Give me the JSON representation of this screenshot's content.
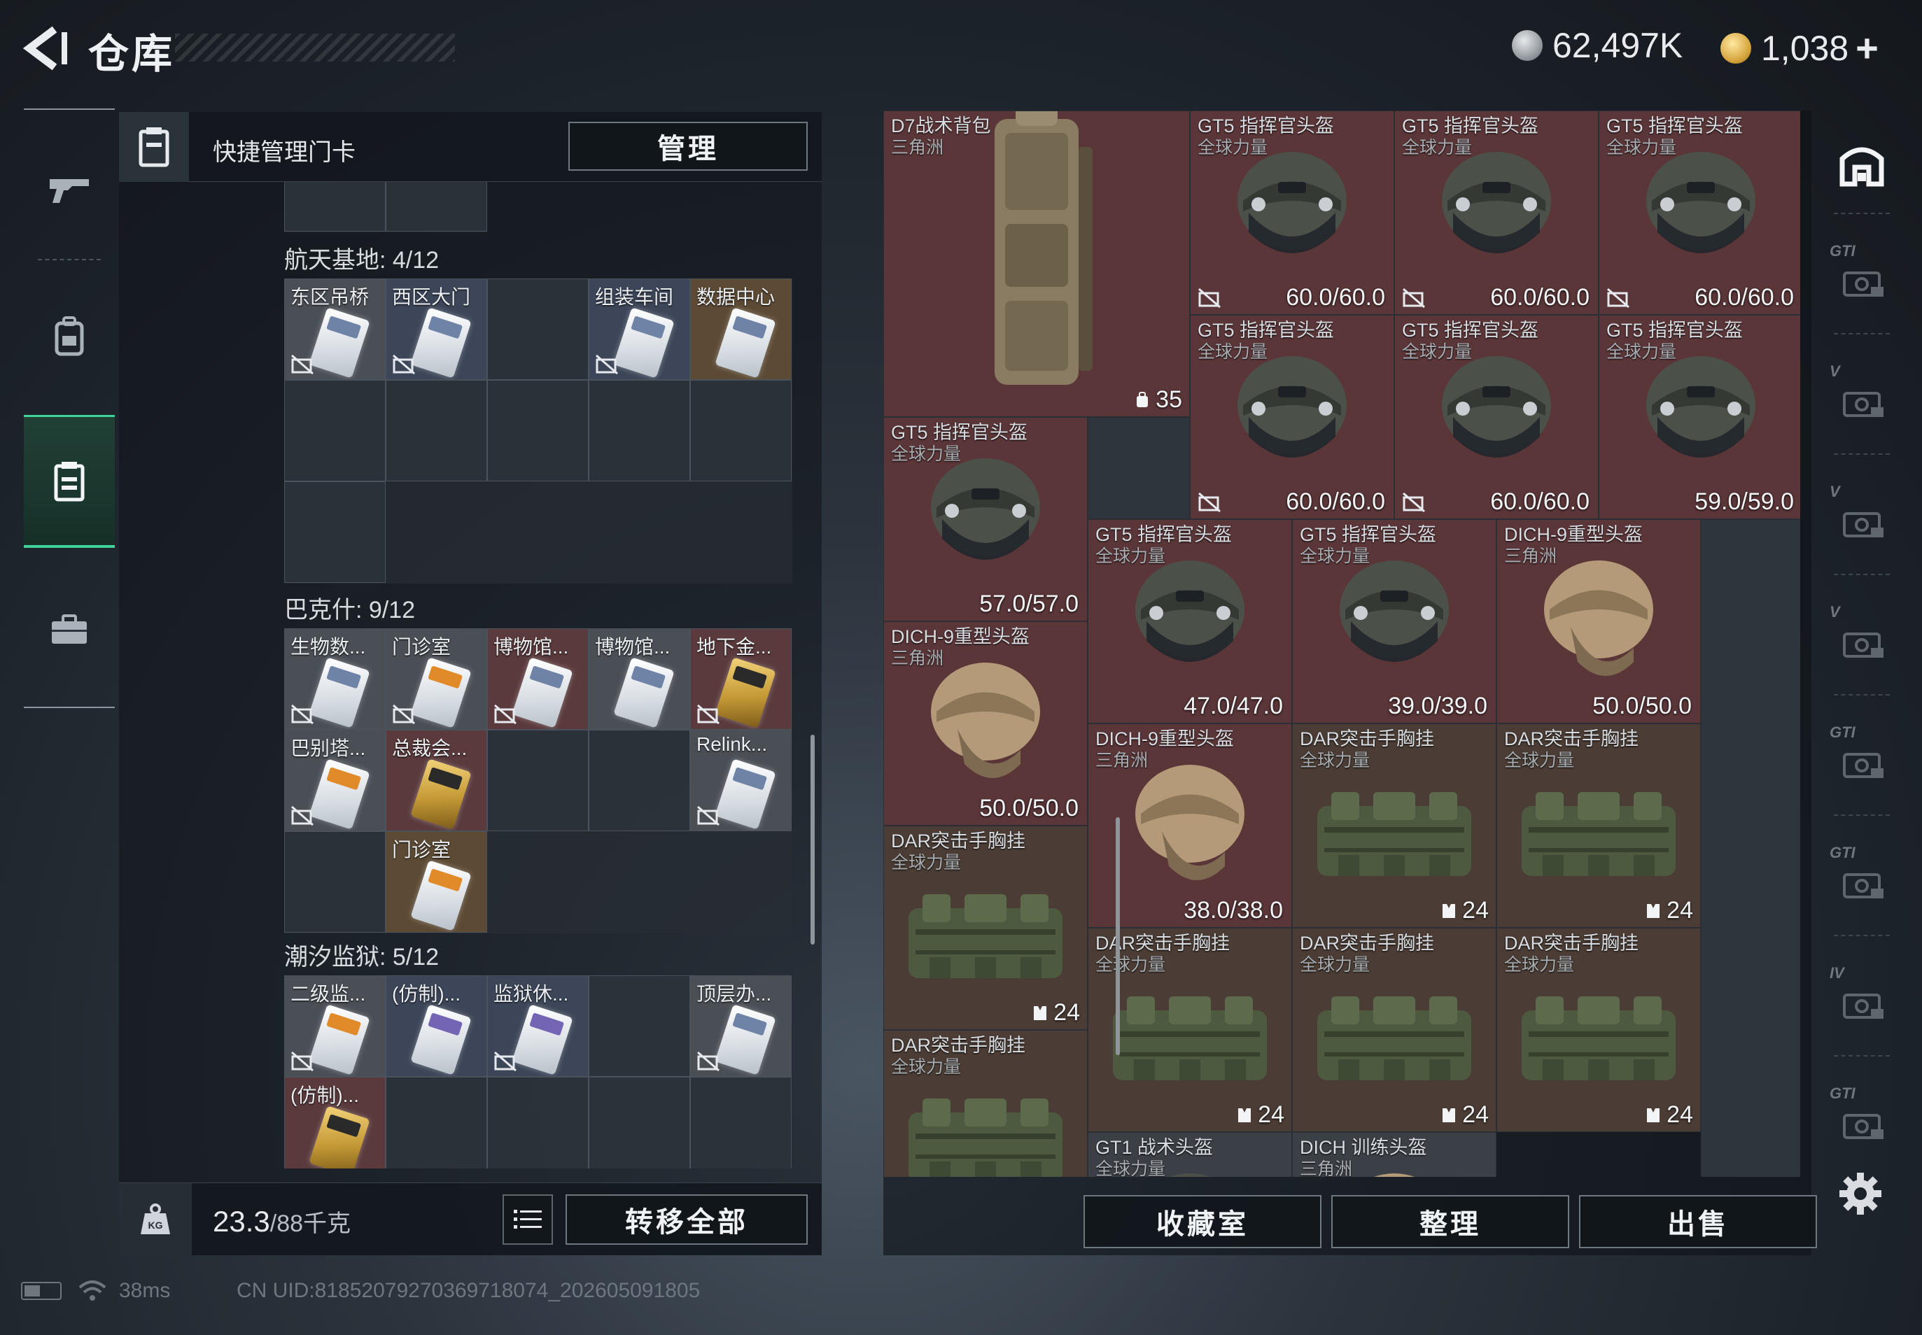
{
  "header": {
    "title": "仓库",
    "currency_silver": "62,497K",
    "currency_gold": "1,038",
    "plus": "+"
  },
  "left_nav": [
    "gun-icon",
    "backpack-icon",
    "keycard-icon",
    "briefcase-icon"
  ],
  "keycard_panel": {
    "header_label": "快捷管理门卡",
    "manage_button": "管理",
    "groups": [
      {
        "title": "航天基地: 4/12",
        "cards": [
          "东区吊桥",
          "西区大门",
          "组装车间",
          "数据中心"
        ]
      },
      {
        "title": "巴克什: 9/12",
        "cards": [
          "生物数...",
          "门诊室",
          "博物馆...",
          "博物馆...",
          "地下金...",
          "巴别塔...",
          "总裁会...",
          "Relink...",
          "门诊室"
        ]
      },
      {
        "title": "潮汐监狱: 5/12",
        "cards": [
          "二级监...",
          "(仿制)...",
          "监狱休...",
          "顶层办...",
          "(仿制)..."
        ]
      }
    ],
    "weight_current": "23.3",
    "weight_max": "/88千克",
    "transfer_button": "转移全部"
  },
  "inventory": {
    "items": [
      {
        "name": "D7战术背包",
        "sub": "三角洲",
        "type": "backpack",
        "capacity": "35"
      },
      {
        "name": "GT5 指挥官头盔",
        "sub": "全球力量",
        "type": "helmet",
        "durability": "60.0/60.0"
      },
      {
        "name": "GT5 指挥官头盔",
        "sub": "全球力量",
        "type": "helmet",
        "durability": "60.0/60.0"
      },
      {
        "name": "GT5 指挥官头盔",
        "sub": "全球力量",
        "type": "helmet",
        "durability": "60.0/60.0"
      },
      {
        "name": "GT5 指挥官头盔",
        "sub": "全球力量",
        "type": "helmet",
        "durability": "60.0/60.0"
      },
      {
        "name": "GT5 指挥官头盔",
        "sub": "全球力量",
        "type": "helmet",
        "durability": "60.0/60.0"
      },
      {
        "name": "GT5 指挥官头盔",
        "sub": "全球力量",
        "type": "helmet",
        "durability": "59.0/59.0"
      },
      {
        "name": "GT5 指挥官头盔",
        "sub": "全球力量",
        "type": "helmet",
        "durability": "57.0/57.0"
      },
      {
        "name": "GT5 指挥官头盔",
        "sub": "全球力量",
        "type": "helmet",
        "durability": "47.0/47.0"
      },
      {
        "name": "GT5 指挥官头盔",
        "sub": "全球力量",
        "type": "helmet",
        "durability": "39.0/39.0"
      },
      {
        "name": "DICH-9重型头盔",
        "sub": "三角洲",
        "type": "helmet-tan",
        "durability": "50.0/50.0"
      },
      {
        "name": "DICH-9重型头盔",
        "sub": "三角洲",
        "type": "helmet-tan",
        "durability": "50.0/50.0"
      },
      {
        "name": "DICH-9重型头盔",
        "sub": "三角洲",
        "type": "helmet-tan",
        "durability": "38.0/38.0"
      },
      {
        "name": "DAR突击手胸挂",
        "sub": "全球力量",
        "type": "vest",
        "capacity": "24"
      },
      {
        "name": "DAR突击手胸挂",
        "sub": "全球力量",
        "type": "vest",
        "capacity": "24"
      },
      {
        "name": "DAR突击手胸挂",
        "sub": "全球力量",
        "type": "vest",
        "capacity": "24"
      },
      {
        "name": "DAR突击手胸挂",
        "sub": "全球力量",
        "type": "vest",
        "capacity": "24"
      },
      {
        "name": "DAR突击手胸挂",
        "sub": "全球力量",
        "type": "vest",
        "capacity": "24"
      },
      {
        "name": "DAR突击手胸挂",
        "sub": "全球力量",
        "type": "vest",
        "capacity": "24"
      },
      {
        "name": "DAR突击手胸挂",
        "sub": "全球力量",
        "type": "vest",
        "capacity": ""
      },
      {
        "name": "GT1 战术头盔",
        "sub": "全球力量",
        "type": "helmet",
        "durability": ""
      },
      {
        "name": "DICH 训练头盔",
        "sub": "三角洲",
        "type": "helmet-tan",
        "durability": ""
      }
    ],
    "buttons": [
      "收藏室",
      "整理",
      "出售"
    ]
  },
  "right_filters": [
    "warehouse-icon",
    "GTI",
    "V",
    "V",
    "V",
    "GTI",
    "GTI",
    "IV",
    "GTI"
  ],
  "status_bar": {
    "ping": "38ms",
    "uid": "CN UID:8185207927036971807​4_202605091805"
  },
  "colors": {
    "accent_green": "#3fd39a",
    "item_red": "#5b3639",
    "item_brown": "#4b3d35"
  }
}
